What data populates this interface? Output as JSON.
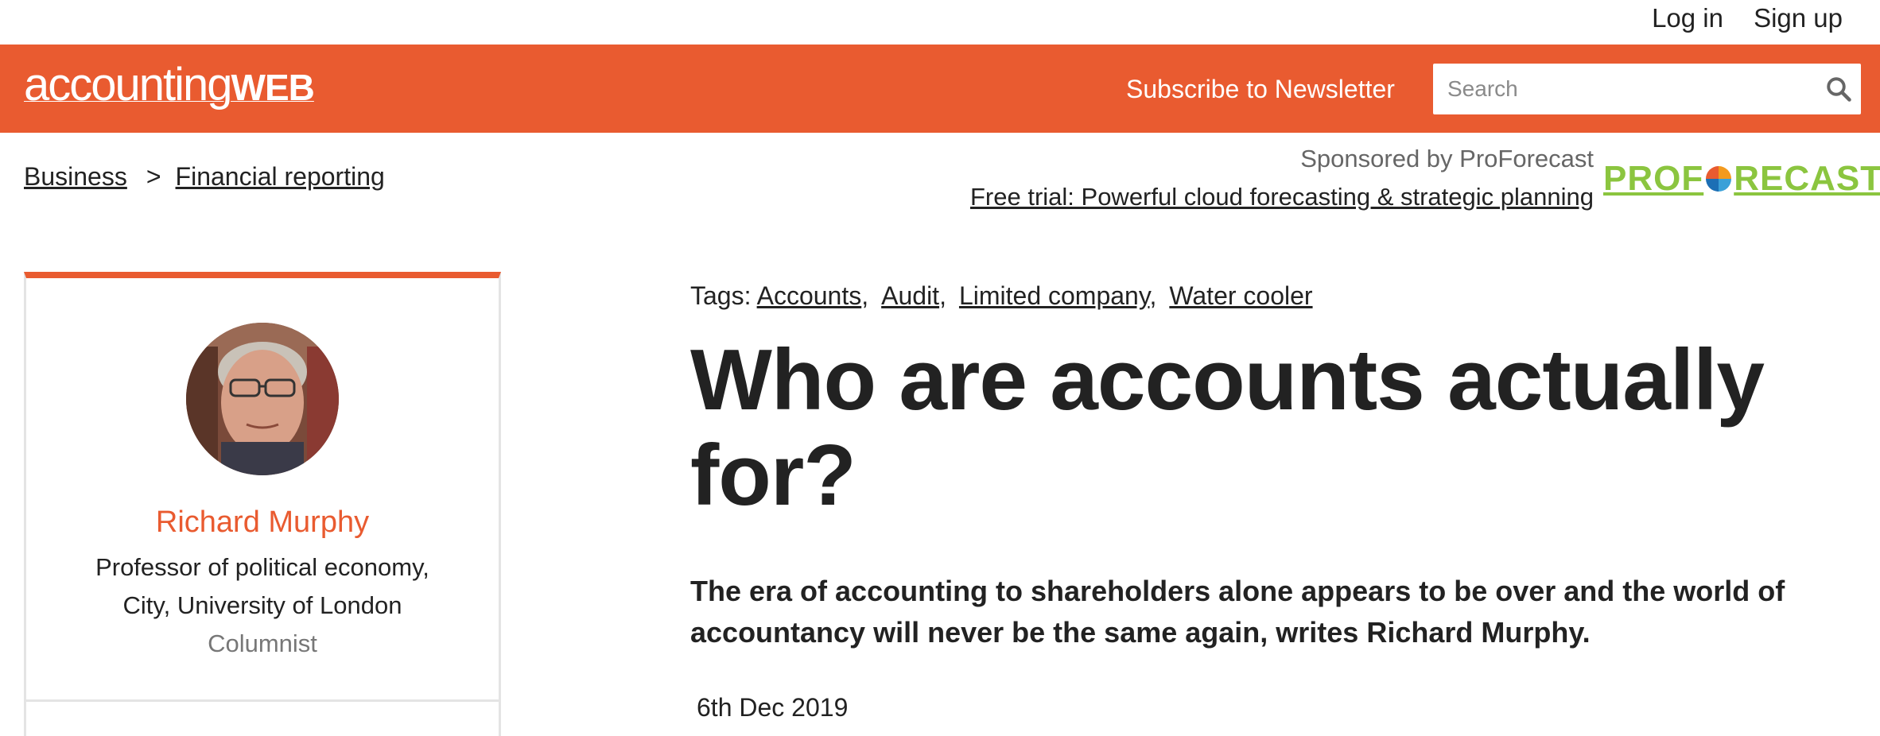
{
  "topbar": {
    "login": "Log in",
    "signup": "Sign up"
  },
  "header": {
    "logo_part1": "accounting",
    "logo_part2": "WEB",
    "subscribe": "Subscribe to Newsletter",
    "search_placeholder": "Search",
    "bg_color": "#e95b30"
  },
  "breadcrumb": {
    "items": [
      "Business",
      "Financial reporting"
    ],
    "separator": ">"
  },
  "sponsor": {
    "by": "Sponsored by ProForecast",
    "link": "Free trial: Powerful cloud forecasting & strategic planning",
    "logo_part1": "PROF",
    "logo_part2": "RECAST",
    "logo_color": "#8bc53f"
  },
  "author": {
    "name": "Richard Murphy",
    "role_line1": "Professor of political economy",
    "role_line1_suffix": ",",
    "role_line2": "City, University of London",
    "type": "Columnist",
    "avatar_icon": "author-photo",
    "accent_color": "#e95b30"
  },
  "article": {
    "tags_label": "Tags:",
    "tags": [
      "Accounts",
      "Audit",
      "Limited company",
      "Water cooler"
    ],
    "title": "Who are accounts actually for?",
    "standfirst": "The era of accounting to shareholders alone appears to be over and the world of accountancy will never be the same again, writes Richard Murphy.",
    "date": "6th Dec 2019"
  }
}
